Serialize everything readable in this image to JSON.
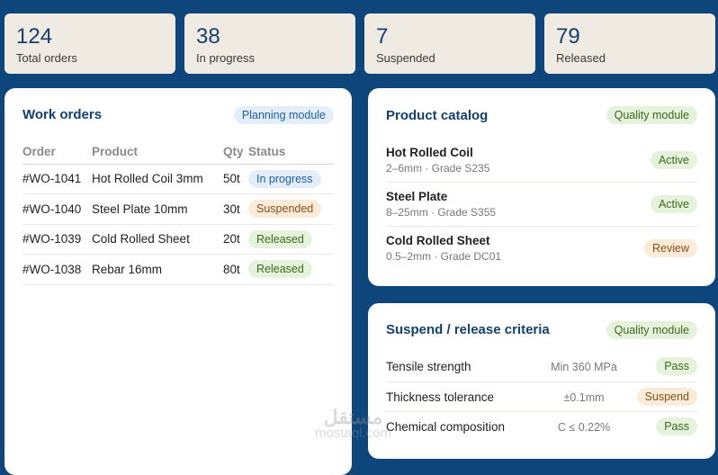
{
  "stats": [
    {
      "value": "124",
      "label": "Total orders"
    },
    {
      "value": "38",
      "label": "In progress"
    },
    {
      "value": "7",
      "label": "Suspended"
    },
    {
      "value": "79",
      "label": "Released"
    }
  ],
  "work_orders": {
    "title": "Work orders",
    "badge": "Planning module",
    "columns": [
      "Order",
      "Product",
      "Qty",
      "Status"
    ],
    "rows": [
      {
        "order": "#WO-1041",
        "product": "Hot Rolled Coil 3mm",
        "qty": "50t",
        "status": "In progress"
      },
      {
        "order": "#WO-1040",
        "product": "Steel Plate 10mm",
        "qty": "30t",
        "status": "Suspended"
      },
      {
        "order": "#WO-1039",
        "product": "Cold Rolled Sheet",
        "qty": "20t",
        "status": "Released"
      },
      {
        "order": "#WO-1038",
        "product": "Rebar 16mm",
        "qty": "80t",
        "status": "Released"
      }
    ]
  },
  "catalog": {
    "title": "Product catalog",
    "badge": "Quality module",
    "items": [
      {
        "name": "Hot Rolled Coil",
        "spec": "2–6mm · Grade S235",
        "status": "Active"
      },
      {
        "name": "Steel Plate",
        "spec": "8–25mm · Grade S355",
        "status": "Active"
      },
      {
        "name": "Cold Rolled Sheet",
        "spec": "0.5–2mm · Grade DC01",
        "status": "Review"
      }
    ]
  },
  "criteria": {
    "title": "Suspend / release criteria",
    "badge": "Quality module",
    "items": [
      {
        "name": "Tensile strength",
        "value": "Min 360 MPa",
        "result": "Pass"
      },
      {
        "name": "Thickness tolerance",
        "value": "±0.1mm",
        "result": "Suspend"
      },
      {
        "name": "Chemical composition",
        "value": "C ≤ 0.22%",
        "result": "Pass"
      }
    ]
  },
  "watermark": {
    "arabic": "مستقل",
    "latin": "mostaql.com"
  }
}
